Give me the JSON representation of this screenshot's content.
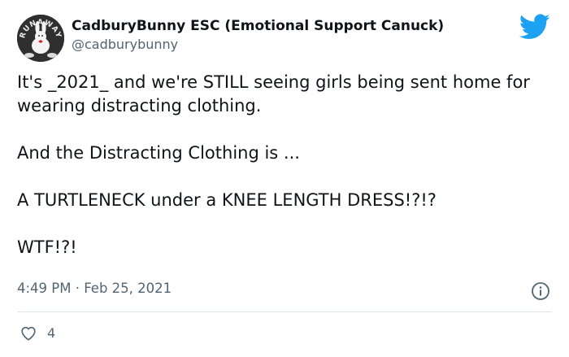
{
  "author": {
    "display_name": "CadburyBunny ESC (Emotional Support Canuck)",
    "handle": "@cadburybunny",
    "avatar_text": "RUNAWAY"
  },
  "tweet": {
    "paragraphs": [
      "It's _2021_ and we're STILL seeing girls being sent home for wearing distracting clothing.",
      "And the Distracting Clothing is ...",
      "A TURTLENECK under a KNEE LENGTH DRESS!?!?",
      "WTF!?!"
    ],
    "timestamp": "4:49 PM · Feb 25, 2021",
    "like_count": "4"
  },
  "colors": {
    "twitter_blue": "#1da1f2",
    "text": "#0f1419",
    "secondary": "#536471",
    "divider": "#dfe5ea"
  },
  "icons": {
    "logo": "twitter-bird-icon",
    "info": "info-icon",
    "like": "heart-icon"
  }
}
